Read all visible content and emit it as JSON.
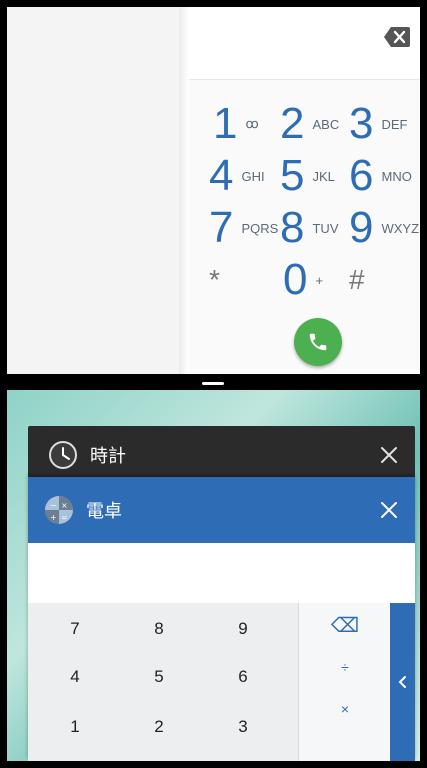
{
  "dialer": {
    "keys": [
      {
        "digit": "1",
        "letters": "ꝏ"
      },
      {
        "digit": "2",
        "letters": "ABC"
      },
      {
        "digit": "3",
        "letters": "DEF"
      },
      {
        "digit": "4",
        "letters": "GHI"
      },
      {
        "digit": "5",
        "letters": "JKL"
      },
      {
        "digit": "6",
        "letters": "MNO"
      },
      {
        "digit": "7",
        "letters": "PQRS"
      },
      {
        "digit": "8",
        "letters": "TUV"
      },
      {
        "digit": "9",
        "letters": "WXYZ"
      },
      {
        "digit": "*",
        "letters": ""
      },
      {
        "digit": "0",
        "letters": "+"
      },
      {
        "digit": "#",
        "letters": ""
      }
    ],
    "icons": {
      "backspace": "backspace-icon",
      "call": "phone-icon"
    },
    "colors": {
      "digit": "#2E6DB5",
      "call": "#4CAF50"
    }
  },
  "recents": {
    "clock_card": {
      "title": "時計",
      "icon": "clock-icon",
      "close": "close-icon"
    },
    "calc_card": {
      "title": "電卓",
      "icon": "calculator-icon",
      "close": "close-icon",
      "pad": [
        "7",
        "8",
        "9",
        "4",
        "5",
        "6",
        "1",
        "2",
        "3"
      ],
      "ops": [
        "⌫",
        "÷",
        "×"
      ],
      "panel_toggle": "chevron-left-icon"
    },
    "colors": {
      "calc_header": "#2E6DB5",
      "clock_header": "#2b2b2b"
    }
  }
}
